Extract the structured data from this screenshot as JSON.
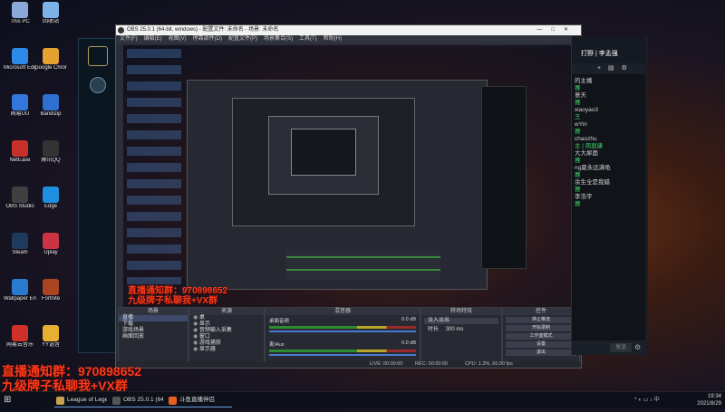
{
  "desktop": {
    "icons": [
      {
        "label": "This PC",
        "color": "#8aa8d8"
      },
      {
        "label": "回收站",
        "color": "#7db3e8"
      },
      {
        "label": "Microsoft Edge",
        "color": "#2d8be8"
      },
      {
        "label": "Google Chrome",
        "color": "#e5a230"
      },
      {
        "label": "网易UU",
        "color": "#3377dd"
      },
      {
        "label": "Bandizip",
        "color": "#2f6fd0"
      },
      {
        "label": "NetEase",
        "color": "#c8312a"
      },
      {
        "label": "腾讯QQ",
        "color": "#333333"
      },
      {
        "label": "OBS Studio",
        "color": "#404040"
      },
      {
        "label": "Edge",
        "color": "#1f8fe0"
      },
      {
        "label": "Steam",
        "color": "#1e3a5f"
      },
      {
        "label": "Uplay",
        "color": "#cc3344"
      },
      {
        "label": "Wallpaper Engine",
        "color": "#2a7ad0"
      },
      {
        "label": "Fortnite",
        "color": "#aa4422"
      },
      {
        "label": "网易云音乐",
        "color": "#d0302a"
      },
      {
        "label": "YY语音",
        "color": "#e8b030"
      }
    ]
  },
  "obs": {
    "title": "OBS 25.0.1 (64-bit, windows) - 配置文件: 未命名 - 场景: 未命名",
    "menu": [
      "文件(F)",
      "编辑(E)",
      "视图(V)",
      "停靠部件(D)",
      "配置文件(P)",
      "场景集合(S)",
      "工具(T)",
      "帮助(H)"
    ],
    "docks": {
      "scenes": {
        "header": "场景",
        "items": [
          "直播",
          "下载",
          "游戏场景",
          "画面回放"
        ]
      },
      "sources": {
        "header": "来源",
        "items": [
          "桌",
          "显示",
          "音频输入采集",
          "窗口",
          "游戏捕获",
          "显示器"
        ]
      },
      "mixer": {
        "header": "混音器",
        "tracks": [
          {
            "name": "桌面音频",
            "db": "0.0 dB"
          },
          {
            "name": "麦/Aux",
            "db": "0.0 dB"
          }
        ]
      },
      "transitions": {
        "header": "转场特效",
        "current": "淡入淡出",
        "duration_label": "时长",
        "duration": "300 ms"
      },
      "controls": {
        "header": "控件",
        "buttons": [
          "停止推流",
          "开始录制",
          "工作室模式",
          "设置",
          "退出"
        ]
      }
    },
    "status": {
      "live": "LIVE: 00:00:00",
      "rec": "REC: 00:00:00",
      "cpu": "CPU: 1.3%, 60.00 fps"
    }
  },
  "chat": {
    "streamer": "打野 | 李孟强",
    "messages": [
      {
        "user": "",
        "text": "的主播"
      },
      {
        "user": "",
        "text": "赛"
      },
      {
        "user": "",
        "text": "意天"
      },
      {
        "user": "",
        "text": "赛"
      },
      {
        "user": "",
        "text": "xiaoyao3"
      },
      {
        "user": "",
        "text": "王"
      },
      {
        "user": "",
        "text": "wYin"
      },
      {
        "user": "",
        "text": "赛"
      },
      {
        "user": "",
        "text": "chaozhu"
      },
      {
        "user": "",
        "text": "主 | 周庭康"
      },
      {
        "user": "",
        "text": "大大犀面"
      },
      {
        "user": "",
        "text": "赛"
      },
      {
        "user": "",
        "text": "ng夏永远满龟"
      },
      {
        "user": "",
        "text": "赛"
      },
      {
        "user": "",
        "text": "余生全是我蜡"
      },
      {
        "user": "",
        "text": "赛"
      },
      {
        "user": "",
        "text": "李浩宇"
      },
      {
        "user": "",
        "text": "赛"
      }
    ],
    "send_label": "发送"
  },
  "overlay": {
    "line1": "直播通知群：970898652",
    "line2": "九级牌子私聊我+VX群"
  },
  "taskbar": {
    "items": [
      {
        "label": "League of Legends",
        "color": "#c8a050"
      },
      {
        "label": "OBS 25.0.1 (64-bi...",
        "color": "#555555"
      },
      {
        "label": "斗鱼直播伴侣",
        "color": "#e86020"
      }
    ],
    "time": "19:34",
    "date": "2021/8/29"
  }
}
